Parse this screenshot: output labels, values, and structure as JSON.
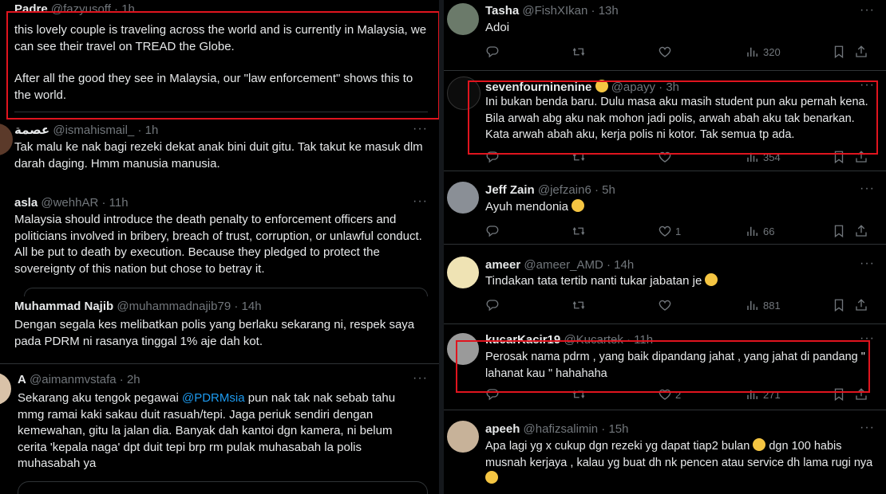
{
  "left": [
    {
      "name": "Padre",
      "handle": "@fazyusoff",
      "time": "1h",
      "paras": [
        "this lovely couple is traveling across the world and is currently in Malaysia, we can see their travel on TREAD the Globe.",
        "After all the good they see in Malaysia, our \"law enforcement\" shows this to the world."
      ]
    },
    {
      "name": "عصمة",
      "handle": "@ismahismail_",
      "time": "1h",
      "text": "Tak malu ke nak bagi rezeki dekat anak bini duit gitu. Tak takut ke masuk dlm darah daging. Hmm manusia manusia."
    },
    {
      "name": "asla",
      "handle": "@wehhAR",
      "time": "11h",
      "text": "Malaysia should introduce the death penalty to enforcement officers and politicians involved in bribery, breach of trust, corruption, or unlawful conduct. All  be put to death by execution. Because they pledged to protect the sovereignty of this nation but chose to betray it."
    },
    {
      "name": "Muhammad Najib",
      "handle": "@muhammadnajib79",
      "time": "14h",
      "text": "Dengan segala kes melibatkan polis yang berlaku sekarang ni, respek saya pada PDRM ni rasanya tinggal 1% aje dah kot."
    },
    {
      "name": "A",
      "handle": "@aimanmvstafa",
      "time": "2h",
      "text_before": "Sekarang aku tengok pegawai ",
      "mention": "@PDRMsia",
      "text_after": " pun nak tak nak sebab tahu mmg ramai kaki sakau duit rasuah/tepi. Jaga periuk sendiri dengan kemewahan, gitu la jalan dia. Banyak dah kantoi dgn kamera, ni belum cerita 'kepala naga' dpt duit tepi brp rm pulak muhasabah la polis muhasabah ya"
    }
  ],
  "right": [
    {
      "name": "Tasha",
      "handle": "@FishXIkan",
      "time": "13h",
      "text": "Adoi",
      "likes": "",
      "views": "320"
    },
    {
      "name": "sevenfourninenine",
      "handle": "@apayy",
      "time": "3h",
      "text": "Ini bukan benda baru. Dulu masa aku masih student pun aku pernah kena. Bila arwah abg aku nak mohon jadi polis, arwah abah aku tak benarkan. Kata arwah abah aku, kerja polis ni kotor. Tak semua tp ada.",
      "likes": "",
      "views": "354"
    },
    {
      "name": "Jeff Zain",
      "handle": "@jefzain6",
      "time": "5h",
      "text": "Ayuh mendonia",
      "likes": "1",
      "views": "66"
    },
    {
      "name": "ameer",
      "handle": "@ameer_AMD",
      "time": "14h",
      "text": "Tindakan tata tertib nanti tukar jabatan je",
      "likes": "",
      "views": "881"
    },
    {
      "name": "kucarKacir19",
      "handle": "@Kucartek",
      "time": "11h",
      "text": "Perosak nama pdrm , yang baik dipandang jahat , yang jahat di pandang \" lahanat kau \" hahahaha",
      "likes": "2",
      "views": "271"
    },
    {
      "name": "apeeh",
      "handle": "@hafizsalimin",
      "time": "15h",
      "text_a": "Apa lagi yg x cukup dgn rezeki yg dapat tiap2 bulan ",
      "text_b": " dgn 100 habis musnah kerjaya , kalau yg buat dh nk pencen atau service dh lama rugi nya"
    }
  ],
  "more_glyph": "···",
  "colors": {
    "background": "#000000",
    "text": "#e7e9ea",
    "muted": "#71767b",
    "link": "#1d9bf0",
    "highlight_box": "#e0141e",
    "divider": "#2f3336"
  },
  "icons": [
    "reply-icon",
    "retweet-icon",
    "like-icon",
    "views-icon",
    "bookmark-icon",
    "share-icon",
    "more-icon"
  ]
}
